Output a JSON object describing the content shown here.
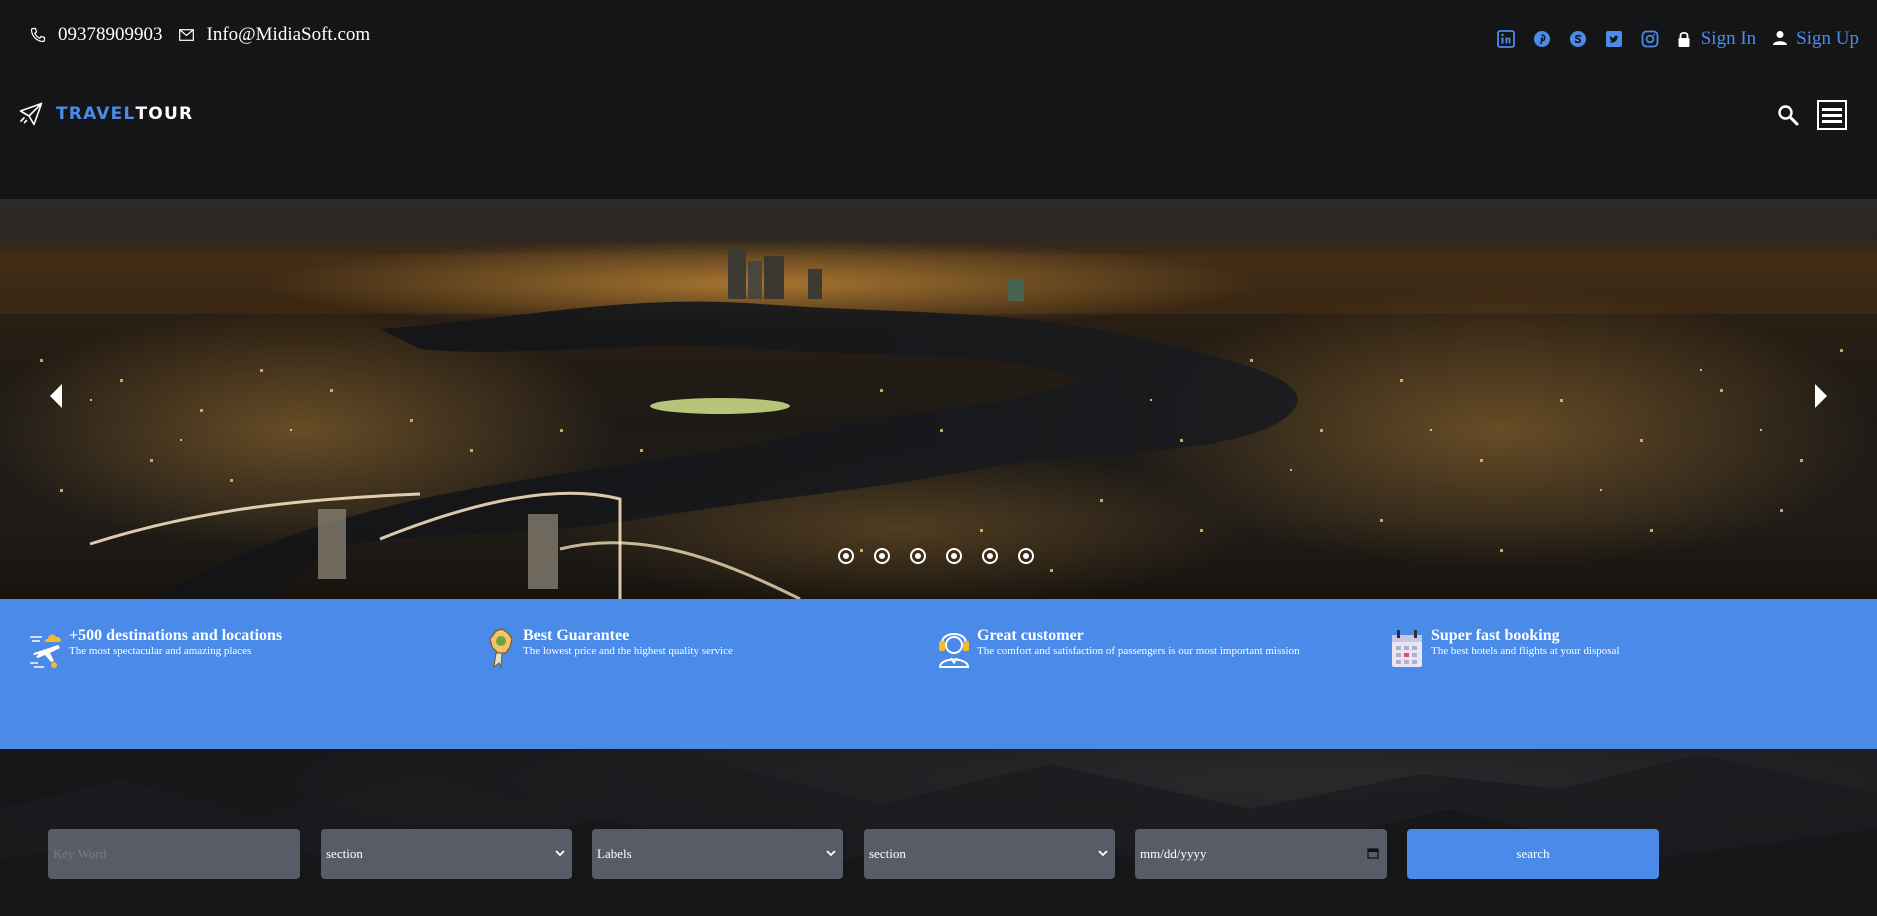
{
  "topbar": {
    "phone": "09378909903",
    "email": "Info@MidiaSoft.com",
    "social_icons": [
      "linkedin-icon",
      "pinterest-icon",
      "skype-icon",
      "twitter-icon",
      "instagram-icon"
    ],
    "sign_in": "Sign In",
    "sign_up": "Sign Up"
  },
  "brand": {
    "part1": "TRAVEL",
    "part2": "TOUR"
  },
  "hero": {
    "slide_count": 6,
    "active_slide": 0
  },
  "features": [
    {
      "title": "+500 destinations and locations",
      "desc": "The most spectacular and amazing places",
      "icon": "plane-cloud-icon"
    },
    {
      "title": "Best Guarantee",
      "desc": "The lowest price and the highest quality service",
      "icon": "guarantee-badge-icon"
    },
    {
      "title": "Great customer",
      "desc": "The comfort and satisfaction of passengers is our most important mission",
      "icon": "support-agent-icon"
    },
    {
      "title": "Super fast booking",
      "desc": "The best hotels and flights at your disposal",
      "icon": "calendar-icon"
    }
  ],
  "search": {
    "keyword_placeholder": "Key Word",
    "select1": "section",
    "select2": "Labels",
    "select3": "section",
    "date_placeholder": "mm/dd/yyyy",
    "button": "search"
  },
  "colors": {
    "accent": "#4a8ae9",
    "link": "#4d8bea",
    "background": "#141517",
    "field": "#585c66"
  }
}
